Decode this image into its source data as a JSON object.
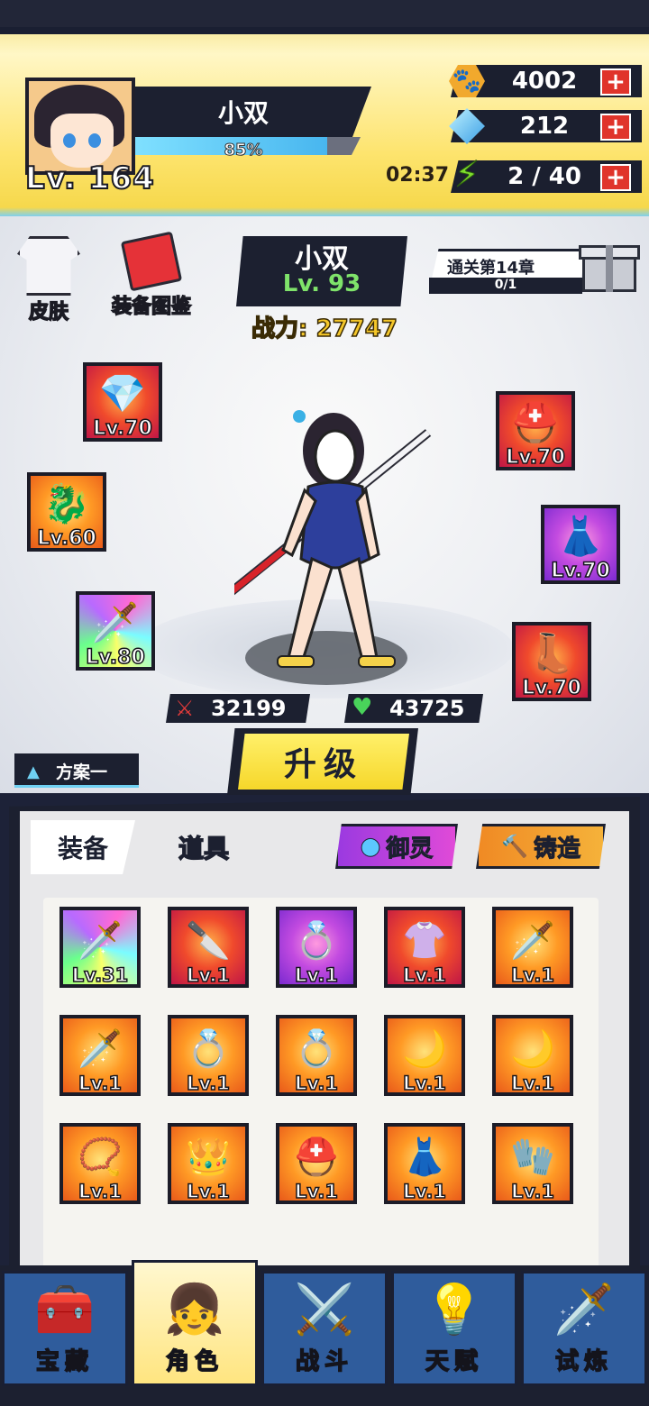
{
  "player": {
    "name": "小双",
    "level": "Lv. 164",
    "exp_text": "85%",
    "exp_fraction": 0.85
  },
  "resources": {
    "coins": "4002",
    "gems": "212",
    "energy_timer": "02:37",
    "energy": "2 / 40",
    "plus": "+"
  },
  "side_menu": {
    "skin": "皮肤",
    "equip_atlas": "装备图鉴"
  },
  "hero": {
    "name": "小双",
    "level": "Lv. 93",
    "power": "战力: 27747",
    "attack": "32199",
    "hp": "43725"
  },
  "chapter_reward": {
    "title": "通关第14章",
    "progress": "0/1"
  },
  "equipped": [
    {
      "slot": "necklace",
      "level": "Lv.70",
      "icon": "necklace-icon"
    },
    {
      "slot": "ring",
      "level": "Lv.60",
      "icon": "dragon-ring-icon"
    },
    {
      "slot": "weapon",
      "level": "Lv.80",
      "icon": "blade-icon"
    },
    {
      "slot": "helmet",
      "level": "Lv.70",
      "icon": "helmet-icon"
    },
    {
      "slot": "armor",
      "level": "Lv.70",
      "icon": "maid-outfit-icon"
    },
    {
      "slot": "boots",
      "level": "Lv.70",
      "icon": "boot-icon"
    }
  ],
  "plan": "方案一",
  "upgrade_label": "升级",
  "inventory": {
    "tab_equipment": "装备",
    "tab_items": "道具",
    "btn_spirit": "御灵",
    "btn_forge": "铸造",
    "items": [
      {
        "level": "Lv.31",
        "icon": "rainbow-blade-icon",
        "bg": "rainbow"
      },
      {
        "level": "Lv.1",
        "icon": "red-sword-icon",
        "bg": "red"
      },
      {
        "level": "Lv.1",
        "icon": "gem-ring-icon",
        "bg": "purple"
      },
      {
        "level": "Lv.1",
        "icon": "sailor-top-icon",
        "bg": "red"
      },
      {
        "level": "Lv.1",
        "icon": "blade-icon",
        "bg": "orange"
      },
      {
        "level": "Lv.1",
        "icon": "blade-icon",
        "bg": "orange"
      },
      {
        "level": "Lv.1",
        "icon": "gem-ring-icon",
        "bg": "orange"
      },
      {
        "level": "Lv.1",
        "icon": "gem-ring-icon",
        "bg": "orange"
      },
      {
        "level": "Lv.1",
        "icon": "jade-pendant-icon",
        "bg": "orange"
      },
      {
        "level": "Lv.1",
        "icon": "jade-pendant-icon",
        "bg": "orange"
      },
      {
        "level": "Lv.1",
        "icon": "bead-necklace-icon",
        "bg": "orange"
      },
      {
        "level": "Lv.1",
        "icon": "tiara-icon",
        "bg": "orange"
      },
      {
        "level": "Lv.1",
        "icon": "helmet-icon",
        "bg": "orange"
      },
      {
        "level": "Lv.1",
        "icon": "maid-outfit-icon",
        "bg": "orange"
      },
      {
        "level": "Lv.1",
        "icon": "glove-icon",
        "bg": "orange"
      }
    ]
  },
  "nav": {
    "treasure": "宝藏",
    "character": "角色",
    "battle": "战斗",
    "talent": "天赋",
    "trial": "试炼"
  }
}
